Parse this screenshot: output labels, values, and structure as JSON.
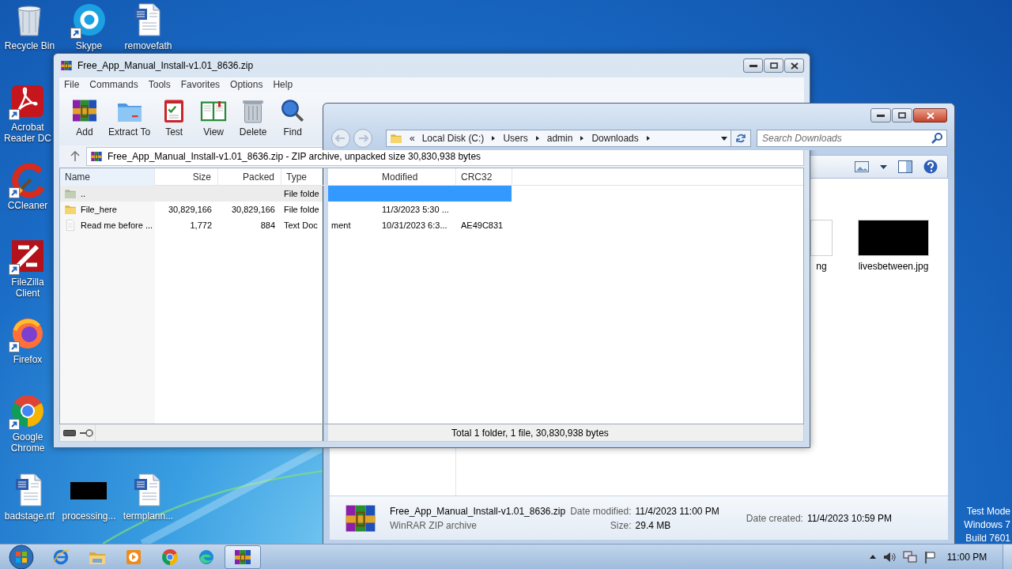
{
  "desktop_icons": [
    {
      "label": "Recycle Bin",
      "kind": "recycle",
      "shortcut": false
    },
    {
      "label": "Skype",
      "kind": "skype",
      "shortcut": true
    },
    {
      "label": "removefath",
      "kind": "word",
      "shortcut": false
    },
    {
      "label": "Acrobat Reader DC",
      "kind": "acrobat",
      "shortcut": true
    },
    {
      "label": "CCleaner",
      "kind": "ccleaner",
      "shortcut": true
    },
    {
      "label": "FileZilla Client",
      "kind": "filezilla",
      "shortcut": true
    },
    {
      "label": "Firefox",
      "kind": "firefox",
      "shortcut": true
    },
    {
      "label": "Google Chrome",
      "kind": "chrome",
      "shortcut": true
    },
    {
      "label": "badstage.rtf",
      "kind": "word",
      "shortcut": false
    },
    {
      "label": "processing...",
      "kind": "black",
      "shortcut": false
    },
    {
      "label": "termplann...",
      "kind": "word",
      "shortcut": false
    }
  ],
  "explorer": {
    "breadcrumb_overflow": "«",
    "breadcrumb": [
      "Local Disk (C:)",
      "Users",
      "admin",
      "Downloads"
    ],
    "search_placeholder": "Search Downloads",
    "items": [
      {
        "label": "ng",
        "kind": "document"
      },
      {
        "label": "livesbetween.jpg",
        "kind": "black"
      }
    ],
    "details": {
      "name": "Free_App_Manual_Install-v1.01_8636.zip",
      "type": "WinRAR ZIP archive",
      "fields": [
        {
          "label": "Date modified:",
          "value": "11/4/2023 11:00 PM"
        },
        {
          "label": "Size:",
          "value": "29.4 MB"
        },
        {
          "label": "Date created:",
          "value": "11/4/2023 10:59 PM"
        }
      ]
    }
  },
  "winrar": {
    "title": "Free_App_Manual_Install-v1.01_8636.zip",
    "menu": [
      "File",
      "Commands",
      "Tools",
      "Favorites",
      "Options",
      "Help"
    ],
    "toolbar": [
      {
        "label": "Add",
        "kind": "add"
      },
      {
        "label": "Extract To",
        "kind": "extract"
      },
      {
        "label": "Test",
        "kind": "test"
      },
      {
        "label": "View",
        "kind": "view"
      },
      {
        "label": "Delete",
        "kind": "delete"
      },
      {
        "label": "Find",
        "kind": "find"
      }
    ],
    "path": "Free_App_Manual_Install-v1.01_8636.zip - ZIP archive, unpacked size 30,830,938 bytes",
    "columns": [
      "Name",
      "Size",
      "Packed",
      "Type",
      "Modified",
      "CRC32"
    ],
    "rows": [
      {
        "kind": "parent",
        "name": "..",
        "type": "File folde",
        "selected": true
      },
      {
        "kind": "folder",
        "name": "File_here",
        "size": "30,829,166",
        "packed": "30,829,166",
        "type": "File folde",
        "modified": "11/3/2023 5:30 ...",
        "selected": false
      },
      {
        "kind": "text",
        "name": "Read me before ...",
        "size": "1,772",
        "packed": "884",
        "type": "Text Doc",
        "type_rest": "ment",
        "modified": "10/31/2023 6:3...",
        "crc": "AE49C831",
        "selected": false
      }
    ],
    "status": "Total 1 folder, 1 file, 30,830,938 bytes"
  },
  "system_text": [
    "Test Mode",
    "Windows 7",
    "Build 7601"
  ],
  "taskbar": {
    "apps": [
      {
        "kind": "ie",
        "active": false
      },
      {
        "kind": "explorer",
        "active": false
      },
      {
        "kind": "media",
        "active": false
      },
      {
        "kind": "chrome",
        "active": false
      },
      {
        "kind": "edge",
        "active": false
      },
      {
        "kind": "winrar",
        "active": true
      }
    ],
    "clock": "11:00 PM"
  }
}
